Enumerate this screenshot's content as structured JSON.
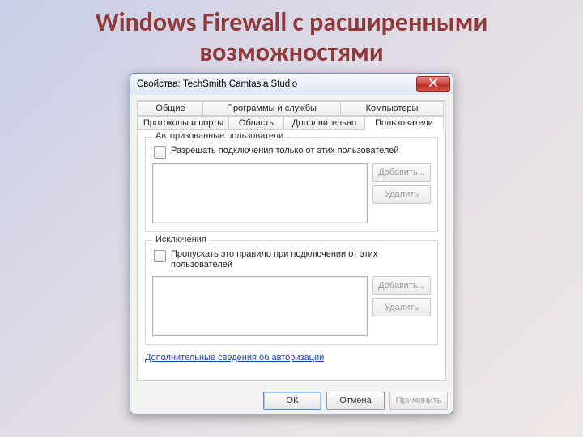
{
  "slide": {
    "title": "Windows Firewall с расширенными возможностями"
  },
  "dialog": {
    "title": "Свойства: TechSmith Camtasia Studio",
    "tabs_row1": [
      {
        "label": "Общие"
      },
      {
        "label": "Программы и службы"
      },
      {
        "label": "Компьютеры"
      }
    ],
    "tabs_row2": [
      {
        "label": "Протоколы и порты"
      },
      {
        "label": "Область"
      },
      {
        "label": "Дополнительно"
      },
      {
        "label": "Пользователи"
      }
    ],
    "group_auth": {
      "title": "Авторизованные пользователи",
      "checkbox": "Разрешать подключения только от этих пользователей",
      "add": "Добавить...",
      "remove": "Удалить"
    },
    "group_exc": {
      "title": "Исключения",
      "checkbox": "Пропускать это правило при подключении от этих пользователей",
      "add": "Добавить...",
      "remove": "Удалить"
    },
    "help_link": "Дополнительные сведения об авторизации",
    "buttons": {
      "ok": "ОК",
      "cancel": "Отмена",
      "apply": "Применить"
    }
  }
}
